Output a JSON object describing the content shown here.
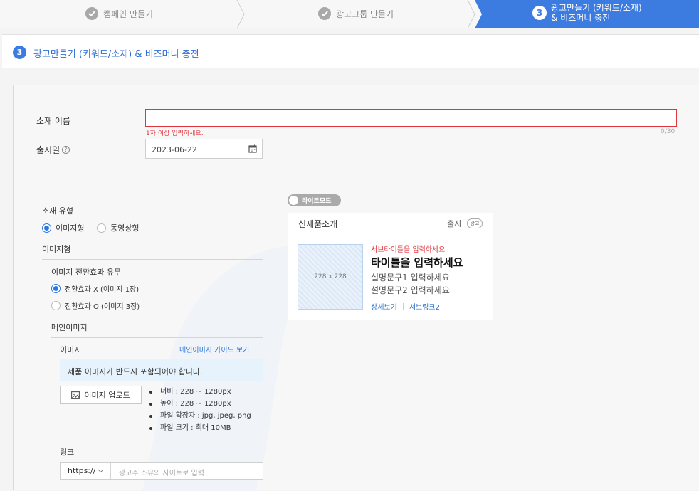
{
  "steps": [
    {
      "label": "캠페인 만들기",
      "done": true
    },
    {
      "label": "광고그룹 만들기",
      "done": true
    },
    {
      "number": "3",
      "label_line1": "광고만들기 (키워드/소재)",
      "label_line2": "& 비즈머니 충전",
      "active": true
    }
  ],
  "header": {
    "number": "3",
    "title": "광고만들기 (키워드/소재) & 비즈머니 충전"
  },
  "form": {
    "name_label": "소재 이름",
    "name_value": "",
    "name_error": "1자 이상 입력하세요.",
    "name_counter": "0/30",
    "release_label": "출시일",
    "release_value": "2023-06-22"
  },
  "creative": {
    "type_label": "소재 유형",
    "type_options": [
      "이미지형",
      "동영상형"
    ],
    "type_selected": "이미지형",
    "section_title": "이미지형",
    "effect_label": "이미지 전환효과 유무",
    "effect_options": [
      "전환효과 X (이미지 1장)",
      "전환효과 O (이미지 3장)"
    ],
    "effect_selected": "전환효과 X (이미지 1장)",
    "main_image_title": "메인이미지",
    "image_label": "이미지",
    "guide_link": "메인이미지 가이드 보기",
    "notice": "제품 이미지가 반드시 포함되어야 합니다.",
    "upload_button": "이미지 업로드",
    "specs": [
      "너비 : 228 ~ 1280px",
      "높이 : 228 ~ 1280px",
      "파일 확장자 : jpg, jpeg, png",
      "파일 크기 : 최대 10MB"
    ],
    "link_label": "링크",
    "link_protocol": "https://",
    "link_placeholder": "광고주 소유의 사이트로 입력"
  },
  "preview": {
    "mode_toggle": "라이트모드",
    "card_title": "신제품소개",
    "card_source": "출시",
    "ad_badge": "광고",
    "thumb_size": "228 x 228",
    "subtitle": "서브타이틀을 입력하세요",
    "title": "타이틀을 입력하세요",
    "desc1": "설명문구1 입력하세요",
    "desc2": "설명문구2 입력하세요",
    "link1": "상세보기",
    "link2": "서브링크2"
  },
  "colors": {
    "accent": "#3c7be0",
    "error": "#e0373e",
    "link": "#2a6fc9",
    "info_bg": "#e6f3fd"
  }
}
